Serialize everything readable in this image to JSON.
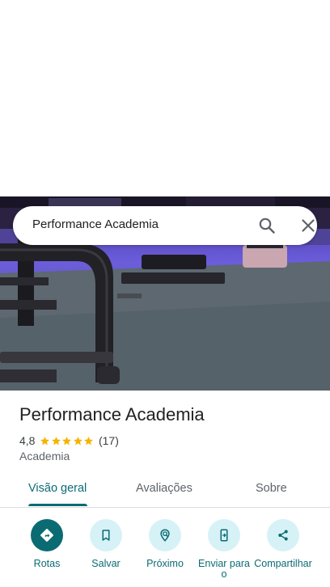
{
  "search": {
    "value": "Performance Academia"
  },
  "place": {
    "name": "Performance Academia",
    "rating": "4,8",
    "stars": 5,
    "reviews_count": "(17)",
    "category": "Academia"
  },
  "tabs": [
    {
      "label": "Visão geral",
      "active": true
    },
    {
      "label": "Avaliações",
      "active": false
    },
    {
      "label": "Sobre",
      "active": false
    }
  ],
  "actions": [
    {
      "label": "Rotas",
      "icon": "directions-icon"
    },
    {
      "label": "Salvar",
      "icon": "bookmark-icon"
    },
    {
      "label": "Próximo",
      "icon": "nearby-icon"
    },
    {
      "label": "Enviar para o",
      "icon": "send-to-phone-icon"
    },
    {
      "label": "Compartilhar",
      "icon": "share-icon"
    }
  ],
  "colors": {
    "accent": "#0b6b73",
    "accent_light": "#d6f2f7",
    "star": "#f4b400"
  }
}
